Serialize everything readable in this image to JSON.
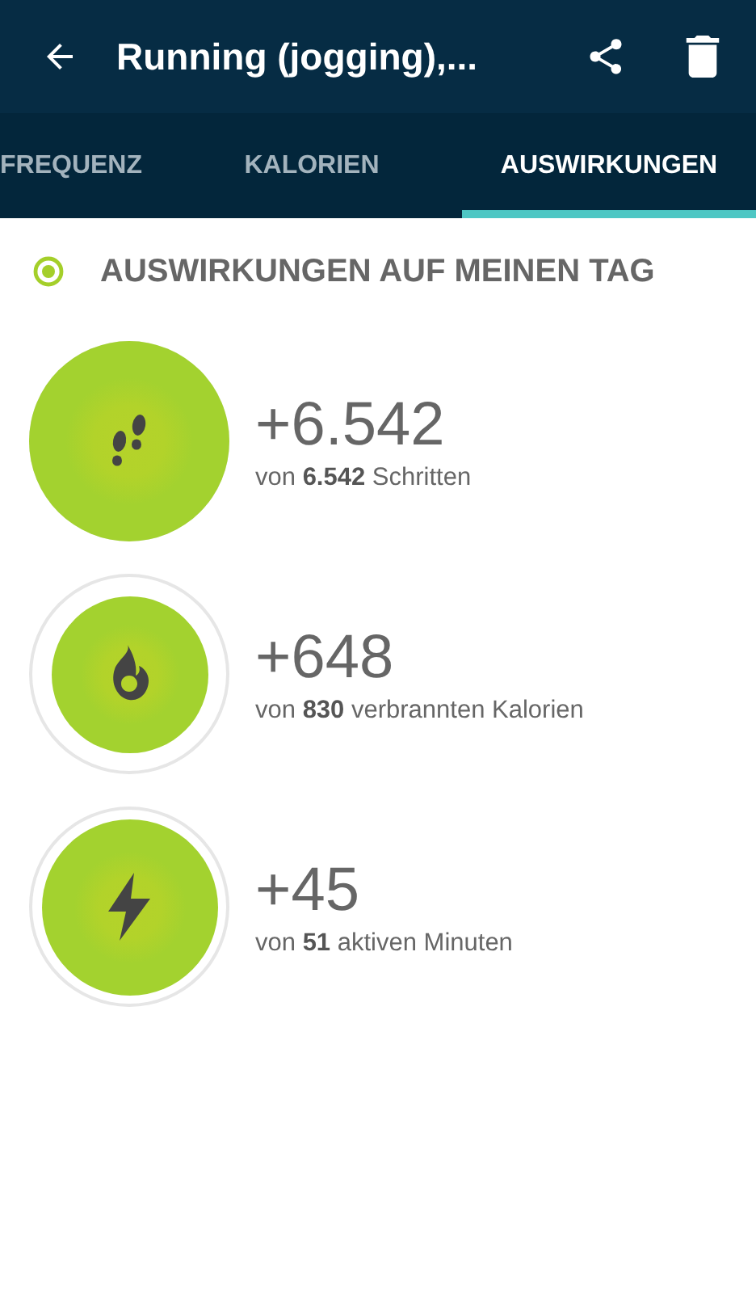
{
  "app_bar": {
    "title": "Running (jogging),..."
  },
  "tabs": [
    {
      "label": "FREQUENZ",
      "selected": false
    },
    {
      "label": "KALORIEN",
      "selected": false
    },
    {
      "label": "AUSWIRKUNGEN",
      "selected": true
    }
  ],
  "section": {
    "title": "AUSWIRKUNGEN AUF MEINEN TAG"
  },
  "stats": [
    {
      "kind": "steps",
      "value": "+6.542",
      "caption": "von **6.542** Schritten"
    },
    {
      "kind": "calories",
      "value": "+648",
      "caption": "von **830** verbrannten Kalorien"
    },
    {
      "kind": "minutes",
      "value": "+45",
      "caption": "von **51** aktiven Minuten"
    }
  ]
}
